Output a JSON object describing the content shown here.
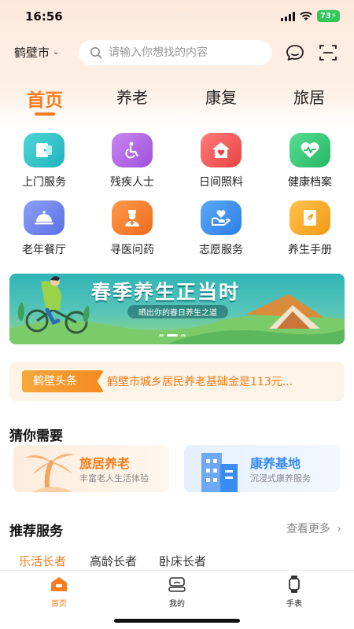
{
  "status_bar": {
    "time": "16:56",
    "battery": "73"
  },
  "header": {
    "city": "鹤壁市",
    "search_placeholder": "请输入你想找的内容"
  },
  "tabs": [
    {
      "label": "首页",
      "active": true
    },
    {
      "label": "养老",
      "active": false
    },
    {
      "label": "康复",
      "active": false
    },
    {
      "label": "旅居",
      "active": false
    }
  ],
  "grid": [
    {
      "label": "上门服务",
      "icon": "door-service-icon",
      "color": "#2ec4c8"
    },
    {
      "label": "残疾人士",
      "icon": "wheelchair-icon",
      "color": "#b662e6"
    },
    {
      "label": "日间照料",
      "icon": "house-heart-icon",
      "color": "#f25b5b"
    },
    {
      "label": "健康档案",
      "icon": "health-heart-icon",
      "color": "#37c978"
    },
    {
      "label": "老年餐厅",
      "icon": "dining-cloche-icon",
      "color": "#6e84f0"
    },
    {
      "label": "寻医问药",
      "icon": "doctor-icon",
      "color": "#f47b2c"
    },
    {
      "label": "志愿服务",
      "icon": "hand-heart-icon",
      "color": "#3a8cf2"
    },
    {
      "label": "养生手册",
      "icon": "handbook-icon",
      "color": "#f5a623"
    }
  ],
  "banner": {
    "title": "春季养生正当时",
    "subtitle": "晒出你的春日养生之道"
  },
  "news": {
    "tag": "鹤壁头条",
    "text": "鹤壁市城乡居民养老基础金是113元..."
  },
  "guess": {
    "title": "猜你需要",
    "cards": [
      {
        "title": "旅居养老",
        "subtitle": "丰富老人生活体验",
        "color": "#f57d1f"
      },
      {
        "title": "康养基地",
        "subtitle": "沉浸式康养服务",
        "color": "#3a8cf2"
      }
    ]
  },
  "recommend": {
    "title": "推荐服务",
    "more": "查看更多",
    "tabs": [
      {
        "label": "乐活长者",
        "active": true
      },
      {
        "label": "高龄长者",
        "active": false
      },
      {
        "label": "卧床长者",
        "active": false
      }
    ]
  },
  "tabbar": [
    {
      "label": "首页",
      "active": true
    },
    {
      "label": "我的",
      "active": false
    },
    {
      "label": "手表",
      "active": false
    }
  ],
  "colors": {
    "accent": "#f57d1f",
    "news_text": "#f07a18"
  }
}
